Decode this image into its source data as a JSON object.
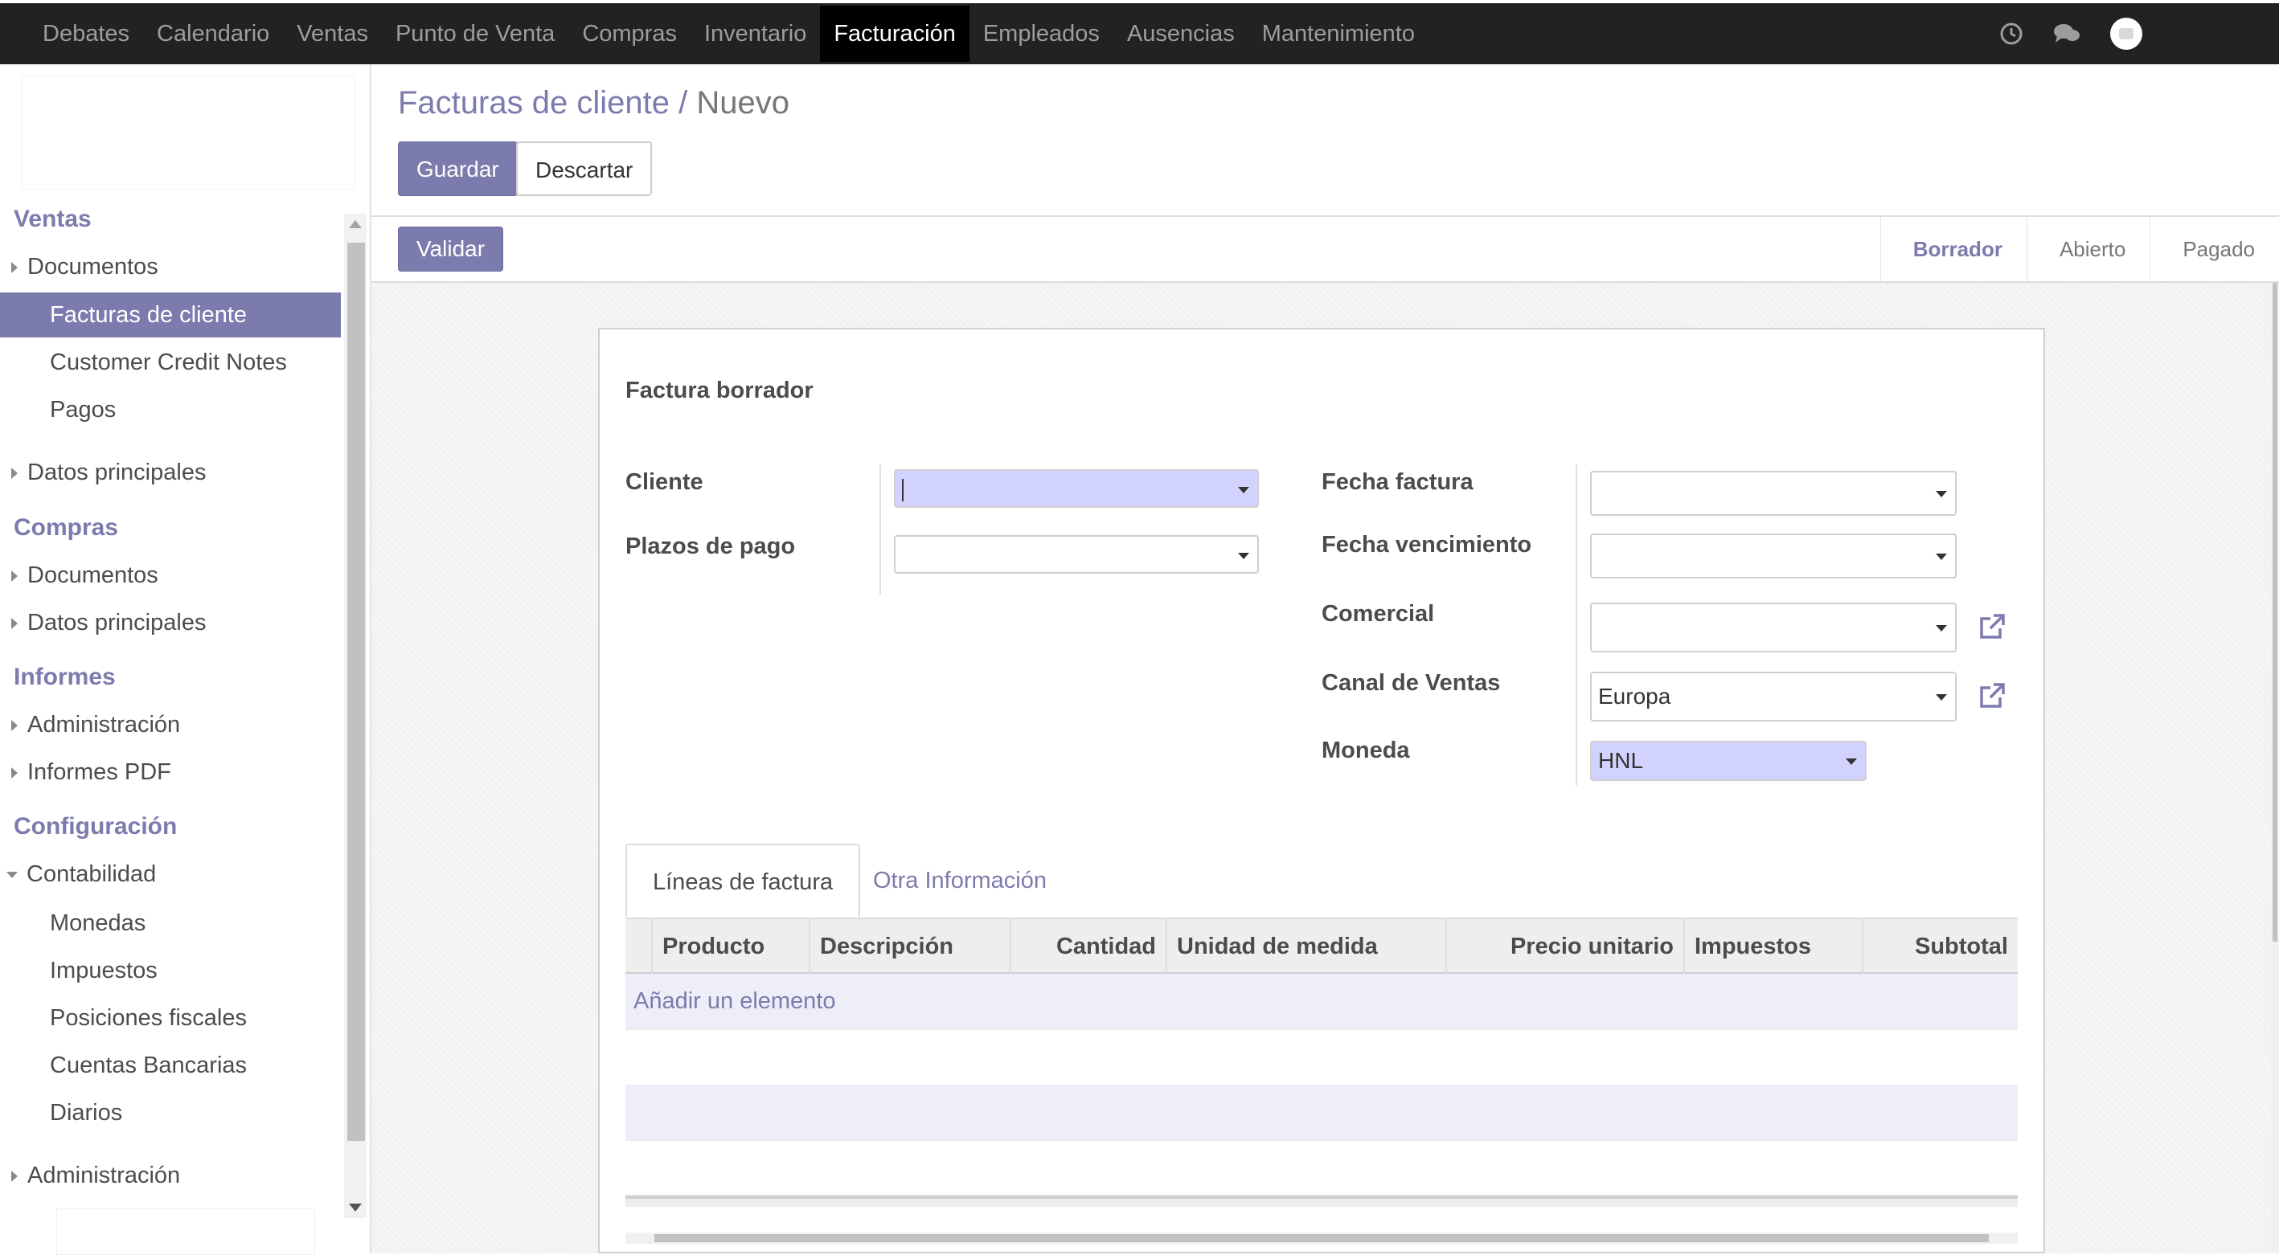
{
  "topbar": {
    "menu": [
      "Debates",
      "Calendario",
      "Ventas",
      "Punto de Venta",
      "Compras",
      "Inventario",
      "Facturación",
      "Empleados",
      "Ausencias",
      "Mantenimiento"
    ],
    "active_index": 6,
    "icons": [
      "clock-icon",
      "chat-icon",
      "user-avatar-icon"
    ]
  },
  "sidebar": {
    "sections": [
      {
        "title": "Ventas",
        "items": [
          {
            "label": "Documentos",
            "caret": "right"
          },
          {
            "label": "Facturas de cliente",
            "active": true
          },
          {
            "label": "Customer Credit Notes"
          },
          {
            "label": "Pagos"
          },
          {
            "label": "Datos principales",
            "caret": "right"
          }
        ]
      },
      {
        "title": "Compras",
        "items": [
          {
            "label": "Documentos",
            "caret": "right"
          },
          {
            "label": "Datos principales",
            "caret": "right"
          }
        ]
      },
      {
        "title": "Informes",
        "items": [
          {
            "label": "Administración",
            "caret": "right"
          },
          {
            "label": "Informes PDF",
            "caret": "right"
          }
        ]
      },
      {
        "title": "Configuración",
        "items": [
          {
            "label": "Contabilidad",
            "caret": "down"
          },
          {
            "label": "Monedas"
          },
          {
            "label": "Impuestos"
          },
          {
            "label": "Posiciones fiscales"
          },
          {
            "label": "Cuentas Bancarias"
          },
          {
            "label": "Diarios"
          },
          {
            "label": "Administración",
            "caret": "right"
          }
        ]
      }
    ]
  },
  "breadcrumb": {
    "parent": "Facturas de cliente",
    "separator": "/",
    "current": "Nuevo"
  },
  "buttons": {
    "save": "Guardar",
    "discard": "Descartar",
    "validate": "Validar"
  },
  "statusbar": {
    "stages": [
      "Borrador",
      "Abierto",
      "Pagado"
    ],
    "active": "Borrador"
  },
  "form": {
    "title": "Factura borrador",
    "left_fields": [
      {
        "label": "Cliente",
        "value": ""
      },
      {
        "label": "Plazos de pago",
        "value": ""
      }
    ],
    "right_fields": [
      {
        "label": "Fecha factura",
        "value": ""
      },
      {
        "label": "Fecha vencimiento",
        "value": ""
      },
      {
        "label": "Comercial",
        "value": ""
      },
      {
        "label": "Canal de Ventas",
        "value": "Europa"
      },
      {
        "label": "Moneda",
        "value": "HNL"
      }
    ]
  },
  "tabs": {
    "items": [
      "Líneas de factura",
      "Otra Información"
    ],
    "active": "Líneas de factura"
  },
  "invoice_lines": {
    "columns": [
      "Producto",
      "Descripción",
      "Cantidad",
      "Unidad de medida",
      "Precio unitario",
      "Impuestos",
      "Subtotal"
    ],
    "add_item": "Añadir un elemento"
  },
  "colors": {
    "brand": "#7c7bad",
    "topbar": "#222222",
    "required_field": "#d2d2ff"
  }
}
